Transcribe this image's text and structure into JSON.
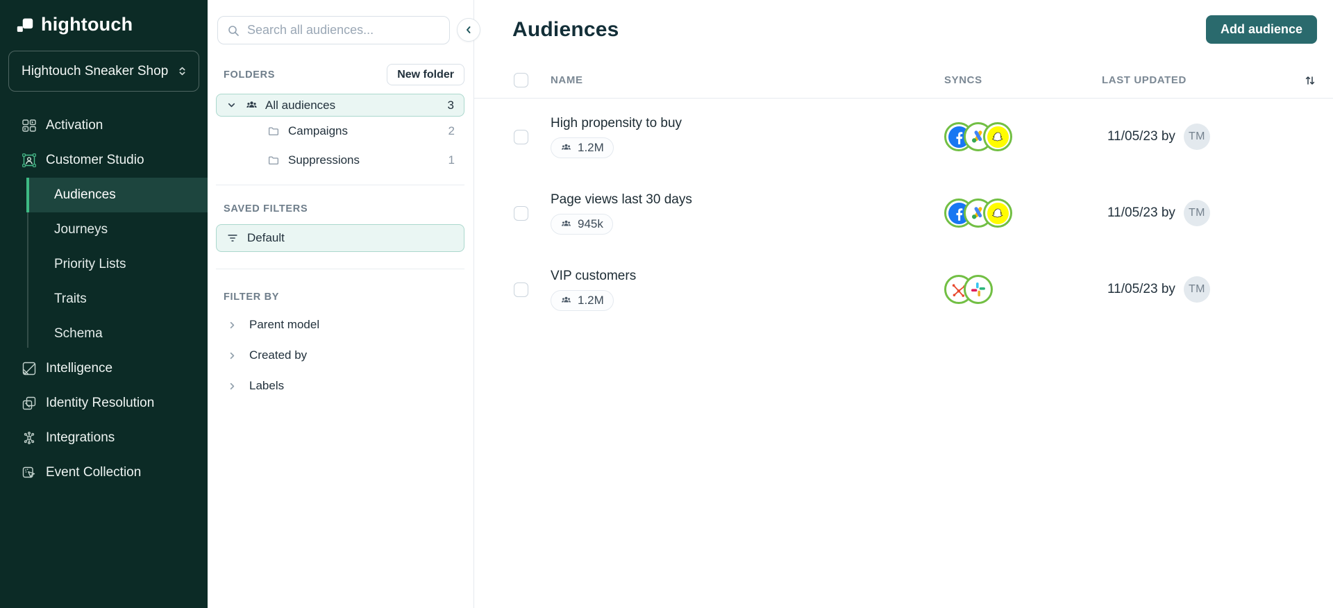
{
  "colors": {
    "sidebar_bg": "#0c2b26",
    "sidebar_active_bg": "#1d453e",
    "accent_green": "#3eba84",
    "brand_teal_button": "#2a6a6d",
    "selected_row_bg": "#eaf6f3",
    "selected_row_border": "#abd8cd",
    "sync_ring_green": "#72bf44",
    "facebook_blue": "#1877F2",
    "snapchat_yellow": "#FFFC00",
    "hubspot_red": "#e8492e",
    "slack_blue": "#36C5F0",
    "slack_green": "#2EB67D",
    "slack_yellow": "#ECB22E",
    "slack_red": "#E01E5A"
  },
  "sidebar": {
    "logo_text": "hightouch",
    "workspace_name": "Hightouch Sneaker Shop",
    "nav": {
      "activation": "Activation",
      "customer_studio": "Customer Studio",
      "audiences": "Audiences",
      "journeys": "Journeys",
      "priority_lists": "Priority Lists",
      "traits": "Traits",
      "schema": "Schema",
      "intelligence": "Intelligence",
      "identity_resolution": "Identity Resolution",
      "integrations": "Integrations",
      "event_collection": "Event Collection"
    }
  },
  "panel": {
    "search_placeholder": "Search all audiences...",
    "folders_label": "FOLDERS",
    "new_folder_button": "New folder",
    "folders": [
      {
        "name": "All audiences",
        "count": "3"
      },
      {
        "name": "Campaigns",
        "count": "2"
      },
      {
        "name": "Suppressions",
        "count": "1"
      }
    ],
    "saved_filters_label": "SAVED FILTERS",
    "default_filter": "Default",
    "filter_by_label": "FILTER BY",
    "filters": [
      {
        "label": "Parent model"
      },
      {
        "label": "Created by"
      },
      {
        "label": "Labels"
      }
    ]
  },
  "main": {
    "title": "Audiences",
    "add_button": "Add audience",
    "columns": {
      "name": "NAME",
      "syncs": "SYNCS",
      "updated": "LAST UPDATED"
    },
    "rows": [
      {
        "name": "High propensity to buy",
        "size": "1.2M",
        "updated": "11/05/23 by",
        "avatar": "TM"
      },
      {
        "name": "Page views last 30 days",
        "size": "945k",
        "updated": "11/05/23 by",
        "avatar": "TM"
      },
      {
        "name": "VIP customers",
        "size": "1.2M",
        "updated": "11/05/23 by",
        "avatar": "TM"
      }
    ]
  }
}
